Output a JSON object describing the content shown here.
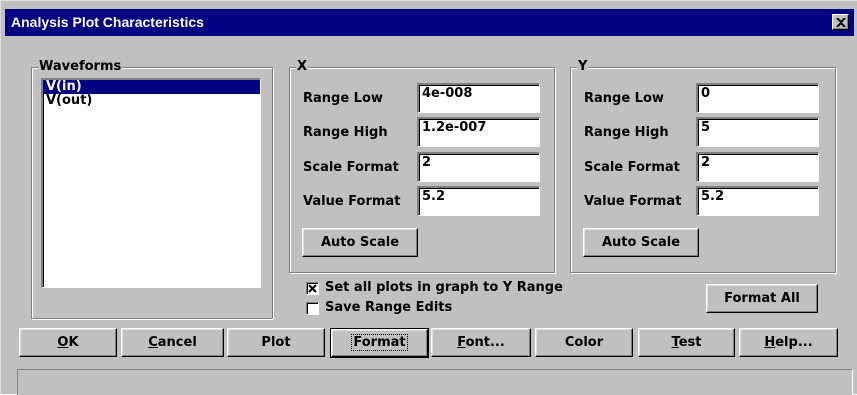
{
  "window": {
    "title": "Analysis Plot Characteristics"
  },
  "waveforms": {
    "legend": "Waveforms",
    "items": [
      {
        "label": "V(in)",
        "selected": true
      },
      {
        "label": "V(out)",
        "selected": false
      }
    ]
  },
  "x_group": {
    "legend": "X",
    "range_low_label": "Range Low",
    "range_low_value": "4e-008",
    "range_high_label": "Range High",
    "range_high_value": "1.2e-007",
    "scale_format_label": "Scale Format",
    "scale_format_value": "2",
    "value_format_label": "Value Format",
    "value_format_value": "5.2",
    "auto_scale_label": "Auto Scale"
  },
  "y_group": {
    "legend": "Y",
    "range_low_label": "Range Low",
    "range_low_value": "0",
    "range_high_label": "Range High",
    "range_high_value": "5",
    "scale_format_label": "Scale Format",
    "scale_format_value": "2",
    "value_format_label": "Value Format",
    "value_format_value": "5.2",
    "auto_scale_label": "Auto Scale"
  },
  "options": {
    "set_all_plots_label": "Set all plots in graph to Y Range",
    "set_all_plots_checked": true,
    "save_range_edits_label": "Save Range Edits",
    "save_range_edits_checked": false
  },
  "format_all_label": "Format All",
  "buttons": {
    "ok": {
      "mnemonic": "O",
      "rest": "K"
    },
    "cancel": {
      "mnemonic": "C",
      "rest": "ancel"
    },
    "plot": "Plot",
    "format": "Format",
    "font": {
      "mnemonic": "F",
      "rest": "ont..."
    },
    "color": "Color",
    "test": {
      "mnemonic": "T",
      "rest": "est"
    },
    "help": {
      "mnemonic": "H",
      "rest": "elp..."
    }
  },
  "status_text": "",
  "colors": {
    "titlebar": "#000080",
    "face": "#c0c0c0",
    "selection": "#000080"
  }
}
